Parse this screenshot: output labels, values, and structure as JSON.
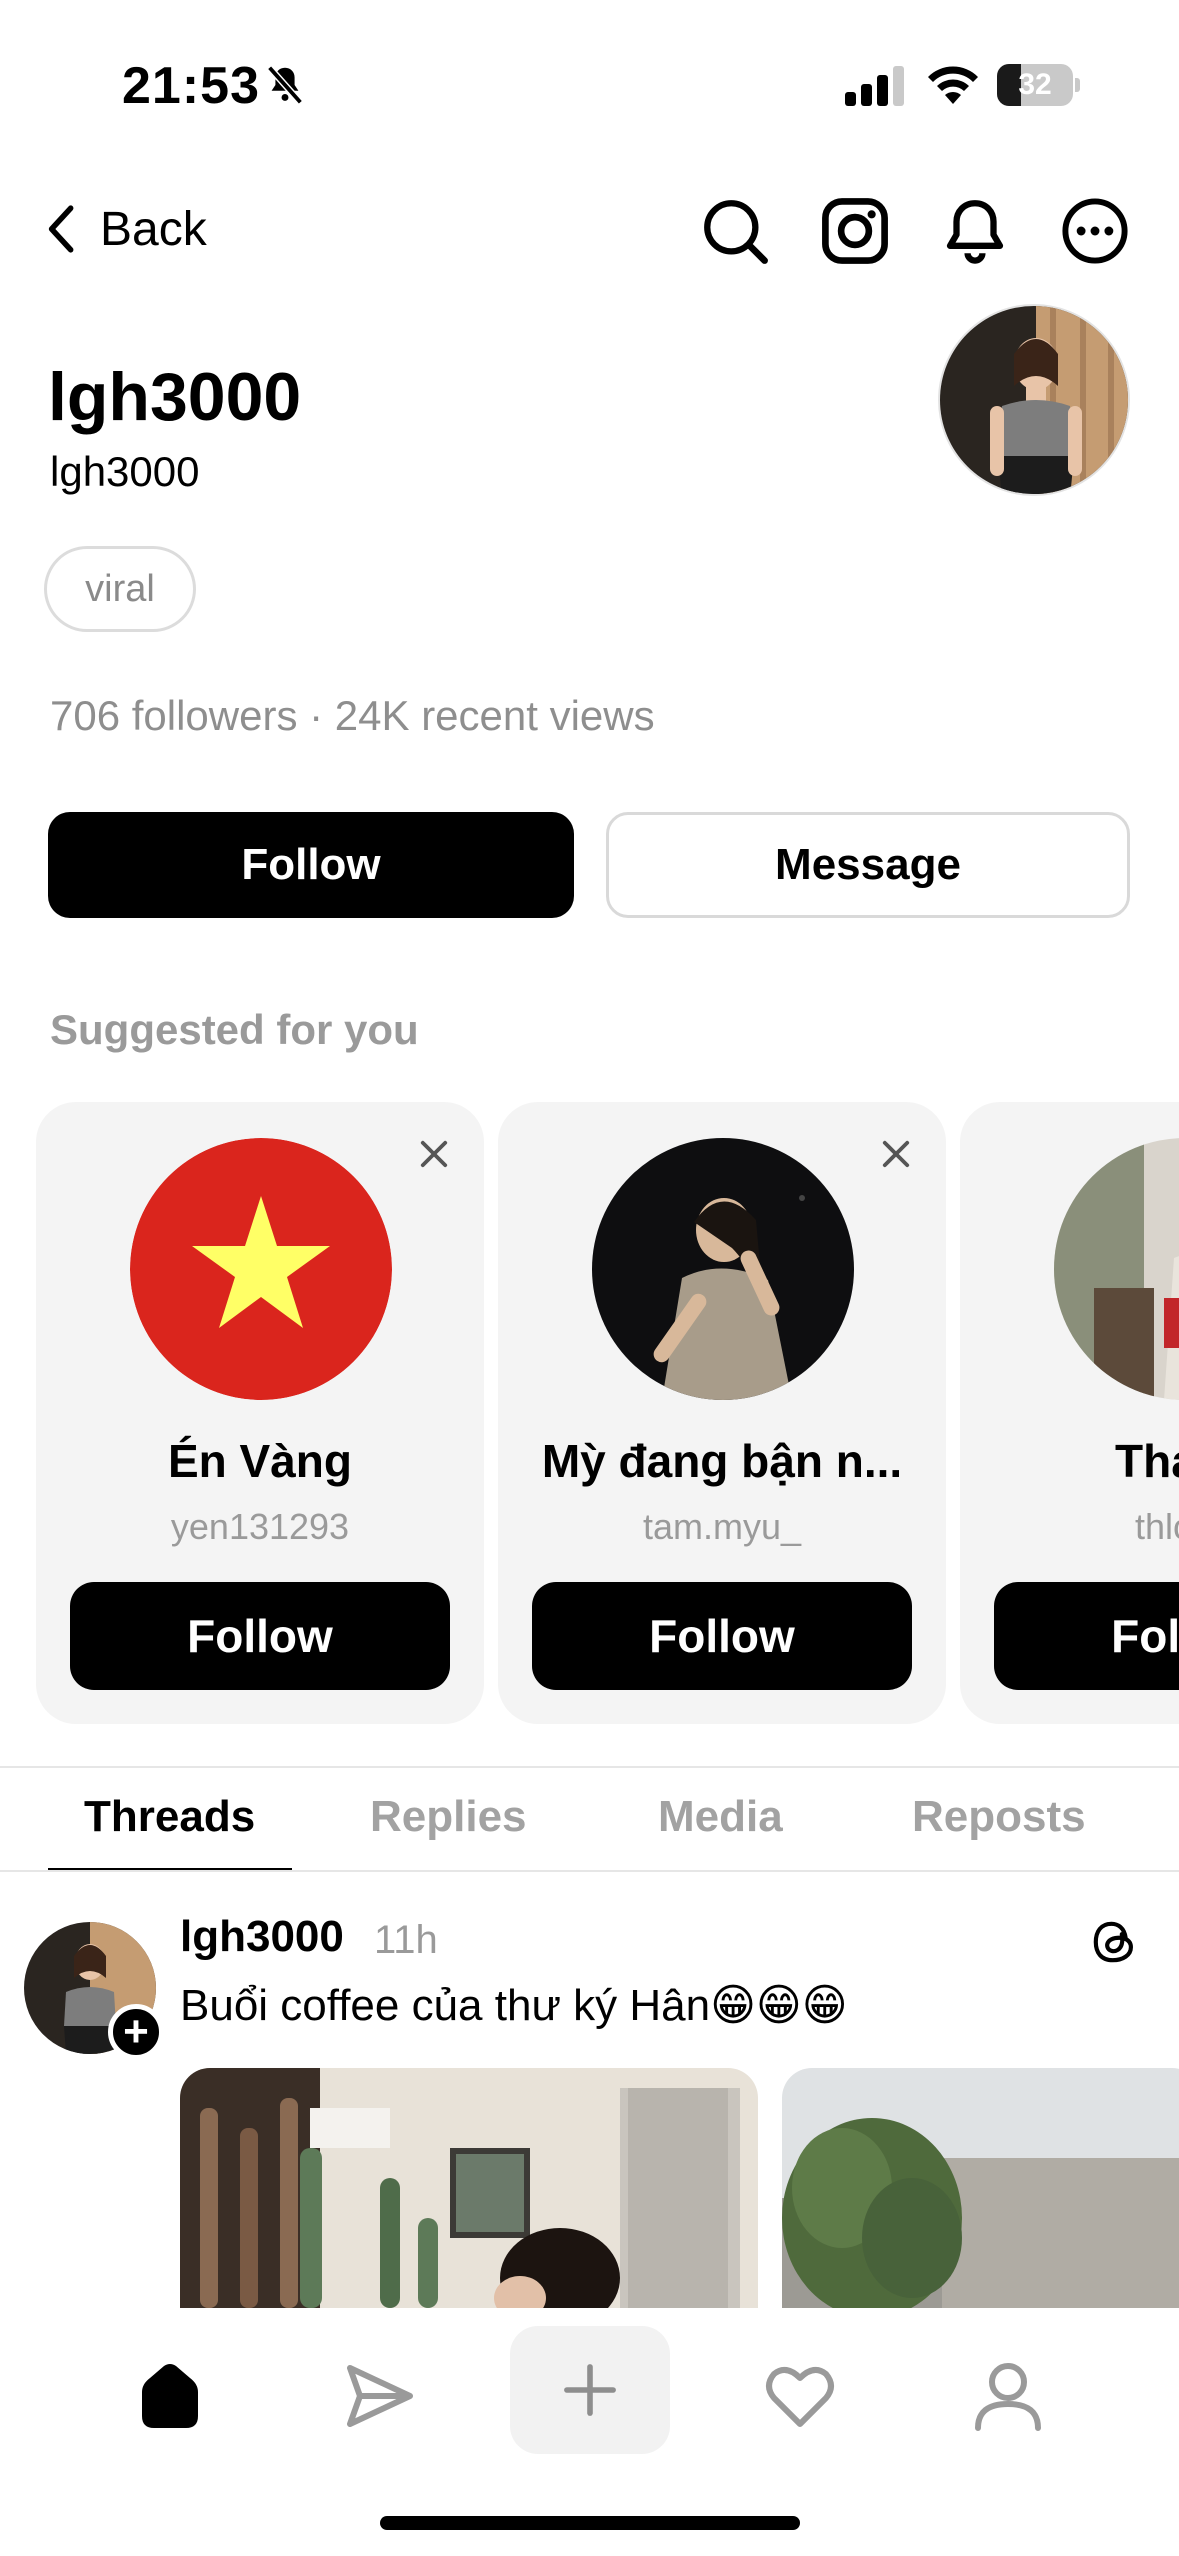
{
  "status_bar": {
    "time": "21:53",
    "battery_level": "32",
    "silent_mode": true
  },
  "nav": {
    "back_label": "Back",
    "icons": [
      "search-icon",
      "instagram-icon",
      "notification-bell-icon",
      "more-options-icon"
    ]
  },
  "profile": {
    "display_name": "lgh3000",
    "username": "lgh3000",
    "tag": "viral",
    "stats": "706 followers · 24K recent views",
    "follow_label": "Follow",
    "message_label": "Message"
  },
  "suggested": {
    "title": "Suggested for you",
    "cards": [
      {
        "name": "Én Vàng",
        "handle": "yen131293",
        "follow_label": "Follow"
      },
      {
        "name": "Mỳ đang bận n...",
        "handle": "tam.myu_",
        "follow_label": "Follow"
      },
      {
        "name": "Thanh",
        "handle": "thloan",
        "follow_label": "Follow"
      }
    ]
  },
  "tabs": [
    {
      "label": "Threads",
      "active": true
    },
    {
      "label": "Replies",
      "active": false
    },
    {
      "label": "Media",
      "active": false
    },
    {
      "label": "Reposts",
      "active": false
    }
  ],
  "post": {
    "username": "lgh3000",
    "time": "11h",
    "text": "Buổi coffee của thư ký Hân😁😁😁"
  },
  "bottom_nav": [
    "home-icon",
    "send-icon",
    "compose-plus-icon",
    "heart-icon",
    "profile-icon"
  ],
  "colors": {
    "primary": "#000000",
    "muted_text": "#9a9a9a",
    "card_bg": "#f4f4f4",
    "flag_red": "#da251d",
    "flag_star": "#ffff66"
  }
}
